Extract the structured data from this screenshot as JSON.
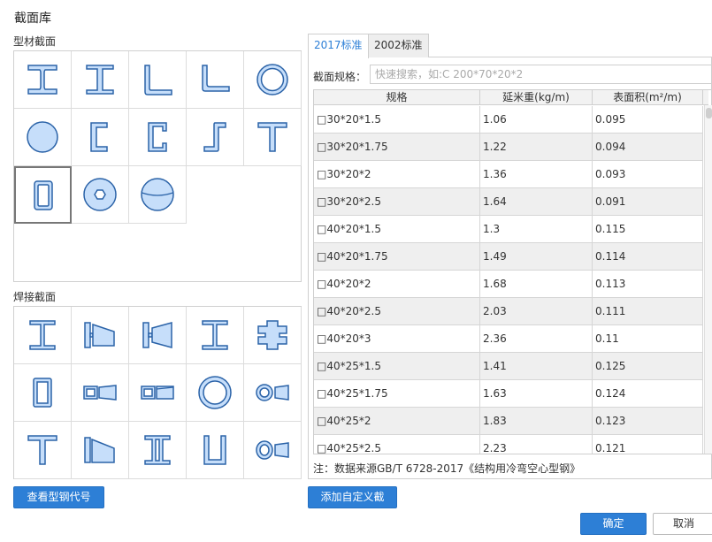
{
  "dialog": {
    "title": "截面库"
  },
  "profile_section": {
    "label": "型材截面",
    "items": [
      {
        "icon": "i-beam-icon"
      },
      {
        "icon": "h-beam-icon"
      },
      {
        "icon": "equal-angle-icon"
      },
      {
        "icon": "unequal-angle-icon"
      },
      {
        "icon": "circular-tube-icon"
      },
      {
        "icon": "round-bar-icon"
      },
      {
        "icon": "channel-icon"
      },
      {
        "icon": "lipped-channel-icon"
      },
      {
        "icon": "z-section-icon"
      },
      {
        "icon": "tee-section-icon"
      },
      {
        "icon": "rectangular-tube-icon"
      },
      {
        "icon": "hexagon-hole-circle-icon"
      },
      {
        "icon": "split-sphere-icon"
      }
    ]
  },
  "welded_section": {
    "label": "焊接截面",
    "items": [
      {
        "icon": "welded-i-beam-icon"
      },
      {
        "icon": "tapered-i-beam-icon"
      },
      {
        "icon": "tapered-h-beam-icon"
      },
      {
        "icon": "welded-h-beam-icon"
      },
      {
        "icon": "cross-section-icon"
      },
      {
        "icon": "welded-box-icon"
      },
      {
        "icon": "tapered-box-icon"
      },
      {
        "icon": "tapered-box-double-icon"
      },
      {
        "icon": "welded-circular-tube-icon"
      },
      {
        "icon": "tapered-circular-tube-icon"
      },
      {
        "icon": "welded-tee-icon"
      },
      {
        "icon": "tapered-tee-icon"
      },
      {
        "icon": "double-channel-icon"
      },
      {
        "icon": "u-section-icon"
      },
      {
        "icon": "tapered-ellipse-icon"
      }
    ]
  },
  "buttons": {
    "view_codes": "查看型钢代号表",
    "add_custom": "添加自定义截面",
    "ok": "确定",
    "cancel": "取消"
  },
  "tabs": [
    {
      "label": "2017标准",
      "active": true
    },
    {
      "label": "2002标准",
      "active": false
    }
  ],
  "search": {
    "label": "截面规格：",
    "placeholder": "快速搜索，如:C 200*70*20*2",
    "value": ""
  },
  "table": {
    "headers": [
      "规格",
      "延米重(kg/m)",
      "表面积(m²/m)"
    ],
    "rows": [
      [
        "□30*20*1.5",
        "1.06",
        "0.095"
      ],
      [
        "□30*20*1.75",
        "1.22",
        "0.094"
      ],
      [
        "□30*20*2",
        "1.36",
        "0.093"
      ],
      [
        "□30*20*2.5",
        "1.64",
        "0.091"
      ],
      [
        "□40*20*1.5",
        "1.3",
        "0.115"
      ],
      [
        "□40*20*1.75",
        "1.49",
        "0.114"
      ],
      [
        "□40*20*2",
        "1.68",
        "0.113"
      ],
      [
        "□40*20*2.5",
        "2.03",
        "0.111"
      ],
      [
        "□40*20*3",
        "2.36",
        "0.11"
      ],
      [
        "□40*25*1.5",
        "1.41",
        "0.125"
      ],
      [
        "□40*25*1.75",
        "1.63",
        "0.124"
      ],
      [
        "□40*25*2",
        "1.83",
        "0.123"
      ],
      [
        "□40*25*2.5",
        "2.23",
        "0.121"
      ]
    ]
  },
  "note": "注：数据来源GB/T 6728-2017《结构用冷弯空心型钢》",
  "colors": {
    "accent": "#2d7fd6",
    "shape_fill": "#c6defa",
    "shape_stroke": "#2b63a8"
  }
}
